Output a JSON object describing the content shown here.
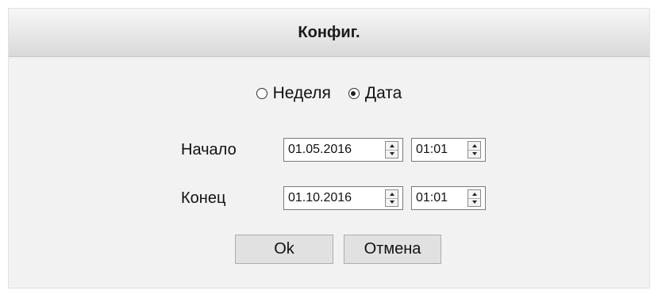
{
  "dialog": {
    "title": "Конфиг.",
    "mode_options": [
      {
        "label": "Неделя",
        "selected": false
      },
      {
        "label": "Дата",
        "selected": true
      }
    ],
    "start": {
      "label": "Начало",
      "date": "01.05.2016",
      "time": "01:01"
    },
    "end": {
      "label": "Конец",
      "date": "01.10.2016",
      "time": "01:01"
    },
    "ok_label": "Ok",
    "cancel_label": "Отмена"
  }
}
